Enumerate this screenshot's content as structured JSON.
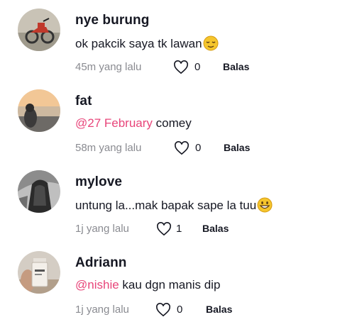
{
  "comments": [
    {
      "username": "nye burung",
      "text": "ok pakcik saya tk lawan",
      "mention": "",
      "emoji": "relieved-face",
      "time": "45m yang lalu",
      "likes": "0",
      "reply_label": "Balas",
      "avatar": "motorcycle-photo"
    },
    {
      "username": "fat",
      "text": "comey",
      "mention": "@27 February",
      "emoji": "",
      "time": "58m yang lalu",
      "likes": "0",
      "reply_label": "Balas",
      "avatar": "sunset-beach-photo"
    },
    {
      "username": "mylove",
      "text": "untung la...mak bapak sape la tuu",
      "mention": "",
      "emoji": "grinning-face",
      "time": "1j yang lalu",
      "likes": "1",
      "reply_label": "Balas",
      "avatar": "black-white-photo"
    },
    {
      "username": "Adriann",
      "text": "kau dgn manis dip",
      "mention": "@nishie",
      "emoji": "",
      "time": "1j yang lalu",
      "likes": "0",
      "reply_label": "Balas",
      "avatar": "serum-bottle-photo"
    }
  ],
  "colors": {
    "mention": "#e8457a",
    "muted": "#8a8b91",
    "text": "#161823",
    "emoji": "#f5c52c"
  }
}
